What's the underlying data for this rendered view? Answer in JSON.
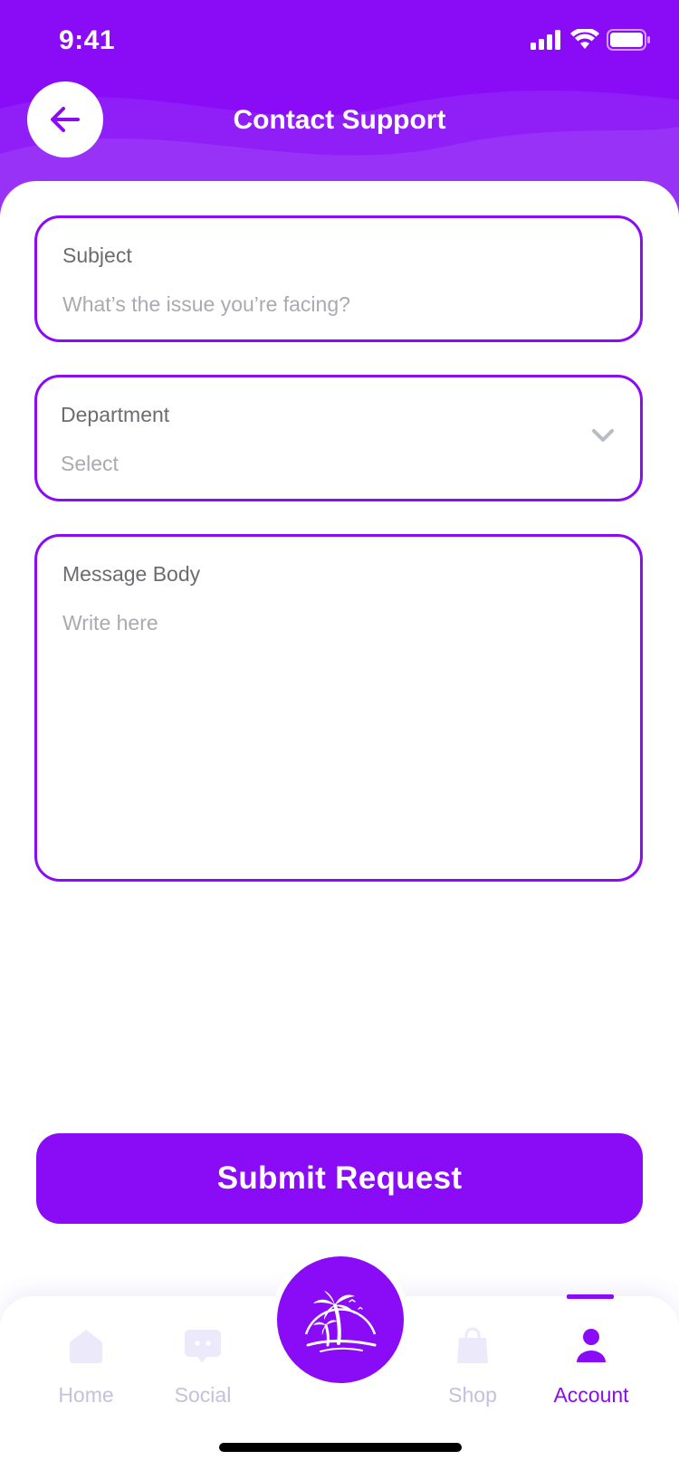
{
  "status_bar": {
    "time": "9:41"
  },
  "header": {
    "title": "Contact Support"
  },
  "form": {
    "subject": {
      "label": "Subject",
      "placeholder": "What’s the issue you’re facing?"
    },
    "department": {
      "label": "Department",
      "placeholder": "Select"
    },
    "message": {
      "label": "Message Body",
      "placeholder": "Write here"
    }
  },
  "submit_label": "Submit Request",
  "tabs": [
    {
      "label": "Home",
      "icon": "home-icon",
      "active": false
    },
    {
      "label": "Social",
      "icon": "chat-icon",
      "active": false
    },
    {
      "label": "Shop",
      "icon": "shopping-bag-icon",
      "active": false
    },
    {
      "label": "Account",
      "icon": "user-icon",
      "active": true
    }
  ],
  "center_button_icon": "palm-tree-icon",
  "colors": {
    "accent": "#8a0bf5",
    "inactive_tab": "#c6c0dd",
    "label": "#6b6b72",
    "placeholder": "#aaaab0"
  }
}
